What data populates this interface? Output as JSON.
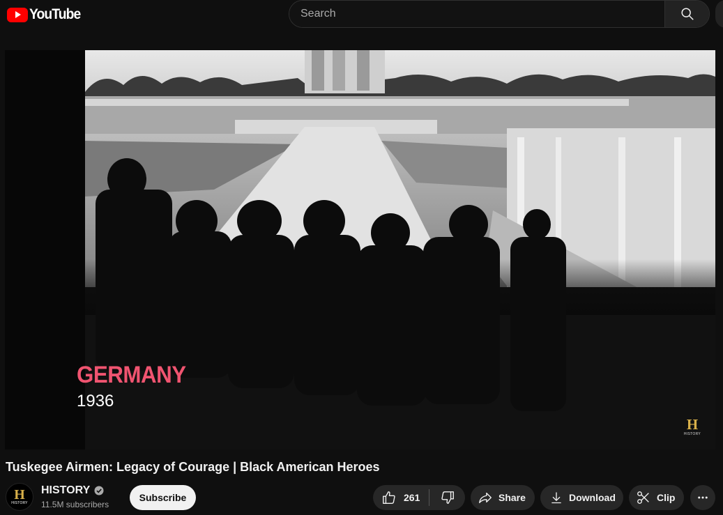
{
  "header": {
    "logo_text": "YouTube",
    "search_placeholder": "Search"
  },
  "player": {
    "caption_place": "GERMANY",
    "caption_year": "1936",
    "watermark_letter": "H",
    "watermark_text": "HISTORY"
  },
  "video": {
    "title": "Tuskegee Airmen: Legacy of Courage | Black American Heroes"
  },
  "channel": {
    "avatar_letter": "H",
    "avatar_text": "HISTORY",
    "name": "HISTORY",
    "subscribers": "11.5M subscribers",
    "subscribe_label": "Subscribe"
  },
  "actions": {
    "like_count": "261",
    "share_label": "Share",
    "download_label": "Download",
    "clip_label": "Clip"
  },
  "icons": {
    "logo": "youtube-play-icon",
    "search": "search-icon",
    "verified": "verified-check-icon",
    "like": "thumbs-up-icon",
    "dislike": "thumbs-down-icon",
    "share": "share-arrow-icon",
    "download": "download-icon",
    "clip": "scissors-icon",
    "more": "more-dots-icon"
  },
  "colors": {
    "background": "#0f0f0f",
    "youtube_red": "#ff0000",
    "caption_pink": "#f05470",
    "history_gold": "#d8b04a",
    "pill": "#272727"
  }
}
